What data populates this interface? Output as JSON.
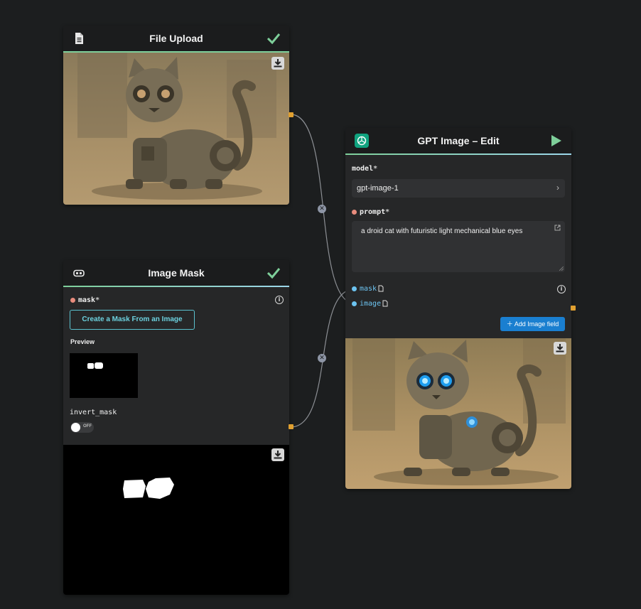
{
  "nodes": {
    "file_upload": {
      "title": "File Upload",
      "status_icon": "check-icon"
    },
    "image_mask": {
      "title": "Image Mask",
      "status_icon": "check-icon",
      "mask_label": "mask",
      "required": "*",
      "create_button": "Create a Mask From an Image",
      "preview_label": "Preview",
      "invert_label": "invert_mask",
      "toggle_state": "OFF"
    },
    "gpt_edit": {
      "title": "GPT Image – Edit",
      "run_icon": "play-icon",
      "model_label": "model",
      "model_value": "gpt-image-1",
      "prompt_label": "prompt",
      "prompt_value": "a droid cat with futuristic light mechanical blue eyes",
      "mask_input": "mask",
      "image_input": "image",
      "add_image_button": "Add Image field"
    }
  },
  "colors": {
    "accent_green": "#7ecf9a",
    "accent_blue": "#9cd6ea",
    "port_orange": "#e0a030",
    "button_blue": "#1a7fd0",
    "mask_button": "#5bc2cf"
  }
}
